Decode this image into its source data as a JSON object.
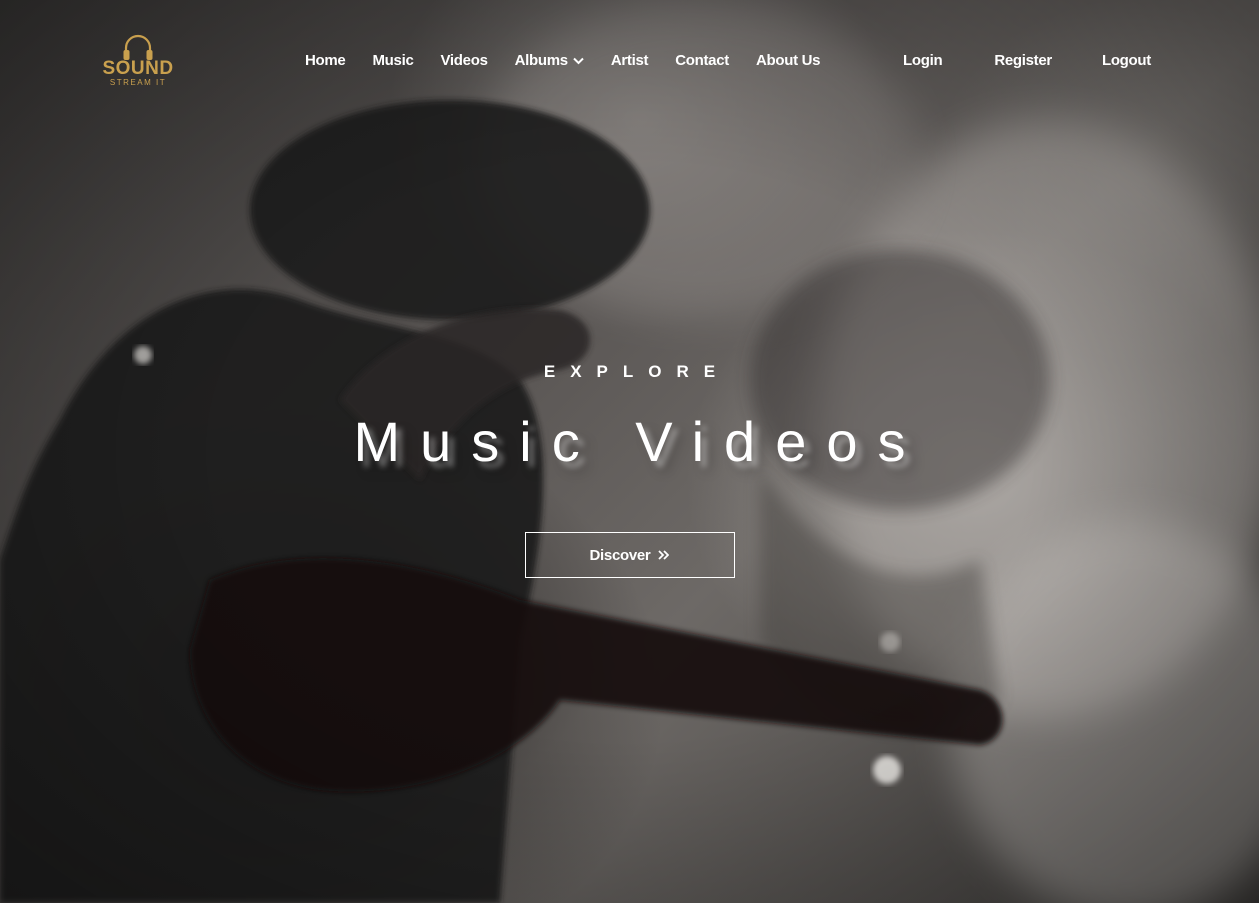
{
  "brand": {
    "name": "SOUND",
    "tagline": "STREAM IT",
    "color": "#c9a04e"
  },
  "nav": {
    "items": [
      {
        "label": "Home"
      },
      {
        "label": "Music"
      },
      {
        "label": "Videos"
      },
      {
        "label": "Albums",
        "has_dropdown": true,
        "icon": "chevron-down-icon"
      },
      {
        "label": "Artist"
      },
      {
        "label": "Contact"
      },
      {
        "label": "About Us"
      }
    ]
  },
  "auth": {
    "login": "Login",
    "register": "Register",
    "logout": "Logout"
  },
  "hero": {
    "eyebrow": "EXPLORE",
    "headline": "Music Videos",
    "cta_label": "Discover",
    "cta_icon": "double-chevron-right-icon"
  }
}
